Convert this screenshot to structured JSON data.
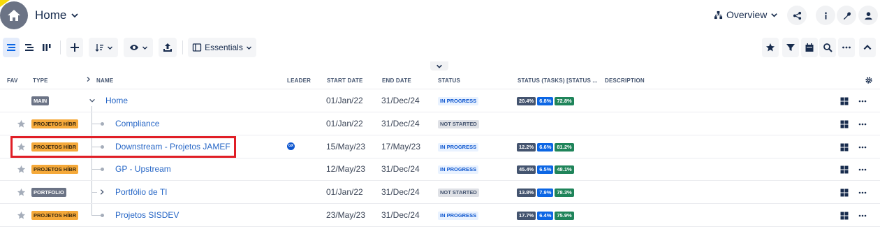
{
  "header": {
    "title": "Home",
    "view_label": "Overview",
    "icons": [
      "home-icon",
      "share-icon",
      "info-icon",
      "wrench-icon",
      "user-icon"
    ]
  },
  "toolbar": {
    "view_select_label": "Essentials"
  },
  "columns": {
    "fav": "FAV",
    "type": "TYPE",
    "name": "NAME",
    "leader": "LEADER",
    "start": "START DATE",
    "end": "END DATE",
    "status": "STATUS",
    "status_tasks": "STATUS (TASKS) [STATUS ...",
    "description": "DESCRIPTION"
  },
  "rows": [
    {
      "type": "MAIN",
      "name": "Home",
      "leader": "",
      "start": "01/Jan/22",
      "end": "31/Dec/24",
      "status": "IN PROGRESS",
      "bars": [
        "20.4%",
        "6.8%",
        "72.8%"
      ]
    },
    {
      "type": "PROJETOS HÍBR",
      "name": "Compliance",
      "leader": "",
      "start": "01/Jan/22",
      "end": "31/Dec/24",
      "status": "NOT STARTED",
      "bars": []
    },
    {
      "type": "PROJETOS HÍBR",
      "name": "Downstream - Projetos JAMEF",
      "leader": "GX",
      "start": "15/May/23",
      "end": "17/May/23",
      "status": "IN PROGRESS",
      "bars": [
        "12.2%",
        "6.6%",
        "81.2%"
      ]
    },
    {
      "type": "PROJETOS HÍBR",
      "name": "GP - Upstream",
      "leader": "",
      "start": "12/May/23",
      "end": "31/Dec/24",
      "status": "IN PROGRESS",
      "bars": [
        "45.4%",
        "6.5%",
        "48.1%"
      ]
    },
    {
      "type": "PORTFOLIO",
      "name": "Portfólio de TI",
      "leader": "",
      "start": "01/Jan/22",
      "end": "31/Dec/24",
      "status": "NOT STARTED",
      "bars": [
        "13.8%",
        "7.9%",
        "78.3%"
      ]
    },
    {
      "type": "PROJETOS HÍBR",
      "name": "Projetos SISDEV",
      "leader": "",
      "start": "23/May/23",
      "end": "31/Dec/24",
      "status": "IN PROGRESS",
      "bars": [
        "17.7%",
        "6.4%",
        "75.9%"
      ]
    }
  ],
  "colors": {
    "link": "#2666c6",
    "in_progress": "#0c55cf",
    "bar_gray": "#44546f",
    "bar_blue": "#0c66e4",
    "bar_green": "#1f845a",
    "lozenge_orange": "#f5a93a",
    "highlight": "#e01e26"
  }
}
